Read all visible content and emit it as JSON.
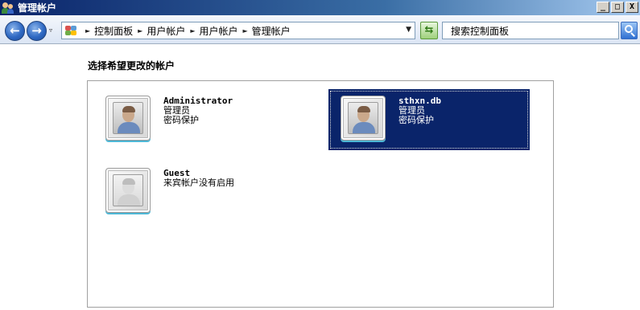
{
  "window": {
    "title": "管理帐户",
    "buttons": {
      "minimize": "_",
      "maximize": "□",
      "close": "X"
    }
  },
  "address": {
    "crumbs": [
      "控制面板",
      "用户帐户",
      "用户帐户",
      "管理帐户"
    ]
  },
  "search": {
    "text": "搜索控制面板"
  },
  "main": {
    "heading": "选择希望更改的帐户",
    "accounts": [
      {
        "name": "Administrator",
        "role": "管理员",
        "status": "密码保护",
        "selected": false
      },
      {
        "name": "sthxn.db",
        "role": "管理员",
        "status": "密码保护",
        "selected": true
      },
      {
        "name": "Guest",
        "role": "来宾帐户没有启用",
        "status": "",
        "selected": false
      }
    ]
  },
  "colors": {
    "selection": "#0a246a",
    "titlebar": "#0a246a"
  }
}
